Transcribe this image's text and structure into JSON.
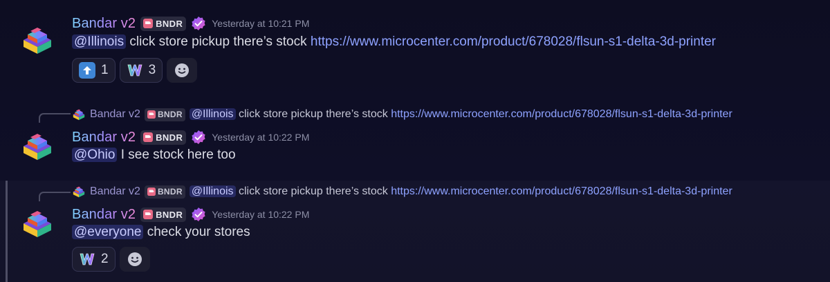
{
  "messages": [
    {
      "author": "Bandar v2",
      "tag": "BNDR",
      "timestamp": "Yesterday at 10:21 PM",
      "mention": "@Illinois",
      "text": " click store pickup there’s stock ",
      "link": "https://www.microcenter.com/product/678028/flsun-s1-delta-3d-printer",
      "reactions": [
        {
          "emoji": "up-arrow-emoji",
          "count": "1"
        },
        {
          "emoji": "w-logo-emoji",
          "count": "3"
        }
      ]
    },
    {
      "reply": {
        "author": "Bandar v2",
        "tag": "BNDR",
        "mention": "@Illinois",
        "text": " click store pickup there’s stock ",
        "link": "https://www.microcenter.com/product/678028/flsun-s1-delta-3d-printer"
      },
      "author": "Bandar v2",
      "tag": "BNDR",
      "timestamp": "Yesterday at 10:22 PM",
      "mention": "@Ohio",
      "text": " I see stock here too"
    },
    {
      "reply": {
        "author": "Bandar v2",
        "tag": "BNDR",
        "mention": "@Illinois",
        "text": " click store pickup there’s stock ",
        "link": "https://www.microcenter.com/product/678028/flsun-s1-delta-3d-printer"
      },
      "author": "Bandar v2",
      "tag": "BNDR",
      "timestamp": "Yesterday at 10:22 PM",
      "mention": "@everyone",
      "text": " check your stores",
      "reactions": [
        {
          "emoji": "w-logo-emoji",
          "count": "2"
        }
      ]
    }
  ],
  "colors": {
    "background": "#0e0e24",
    "mention_bg": "#3a3f8a",
    "link": "#8ea2ff",
    "timestamp": "#8d8fa6"
  }
}
